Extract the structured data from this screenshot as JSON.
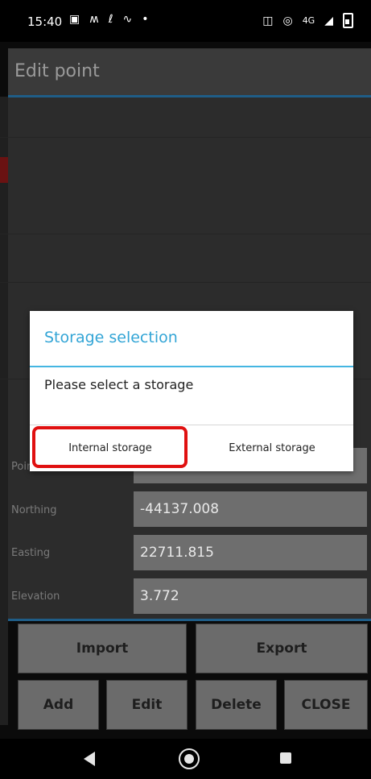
{
  "status_bar": {
    "time": "15:40",
    "network": "4G"
  },
  "app_bar": {
    "title": "Edit point"
  },
  "fields": [
    {
      "label": "Point",
      "value": ""
    },
    {
      "label": "Northing",
      "value": "-44137.008"
    },
    {
      "label": "Easting",
      "value": "22711.815"
    },
    {
      "label": "Elevation",
      "value": "3.772"
    }
  ],
  "buttons": {
    "import": "Import",
    "export": "Export",
    "add": "Add",
    "edit": "Edit",
    "delete": "Delete",
    "close": "CLOSE"
  },
  "dialog": {
    "title": "Storage selection",
    "message": "Please select a storage",
    "internal": "Internal storage",
    "external": "External storage"
  },
  "colors": {
    "accent": "#33a5d6",
    "highlight": "#e01010",
    "button_bg": "#6b6b6b"
  }
}
